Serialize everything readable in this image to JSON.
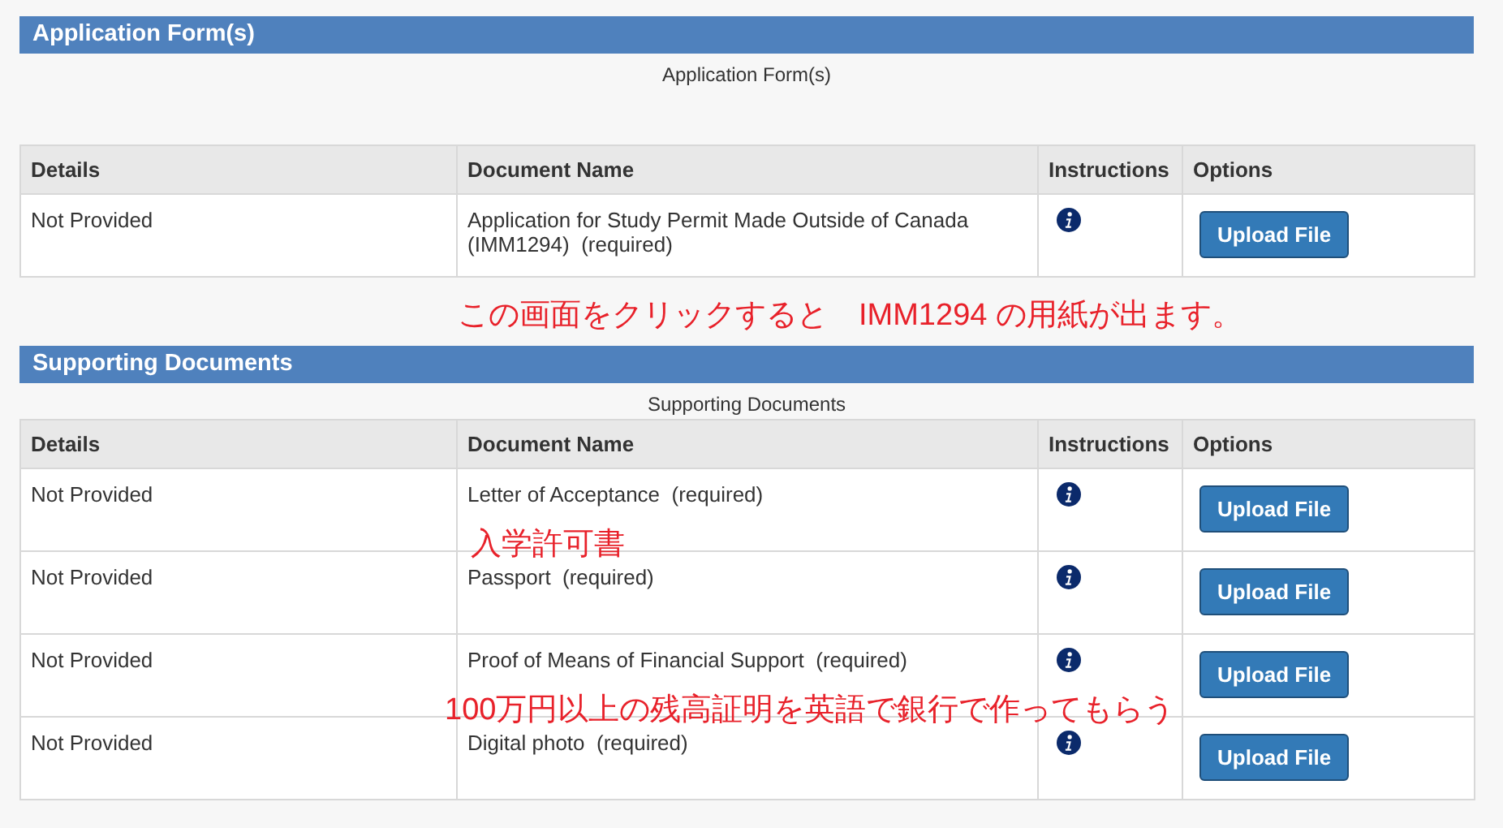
{
  "sections": [
    {
      "title": "Application Form(s)",
      "caption": "Application Form(s)",
      "columns": [
        "Details",
        "Document Name",
        "Instructions",
        "Options"
      ],
      "rows": [
        {
          "details": "Not Provided",
          "document": "Application for Study Permit Made Outside of Canada (IMM1294)  (required)",
          "button": "Upload File"
        }
      ],
      "note": "この画面をクリックすると　IMM1294 の用紙が出ます。"
    },
    {
      "title": "Supporting Documents",
      "caption": "Supporting Documents",
      "columns": [
        "Details",
        "Document Name",
        "Instructions",
        "Options"
      ],
      "rows": [
        {
          "details": "Not Provided",
          "document": "Letter of Acceptance  (required)",
          "button": "Upload File",
          "annotation": "入学許可書"
        },
        {
          "details": "Not Provided",
          "document": "Passport  (required)",
          "button": "Upload File"
        },
        {
          "details": "Not Provided",
          "document": "Proof of Means of Financial Support  (required)",
          "button": "Upload File",
          "annotation": "100万円以上の残高証明を英語で銀行で作ってもらう"
        },
        {
          "details": "Not Provided",
          "document": "Digital photo  (required)",
          "button": "Upload File"
        }
      ]
    }
  ]
}
